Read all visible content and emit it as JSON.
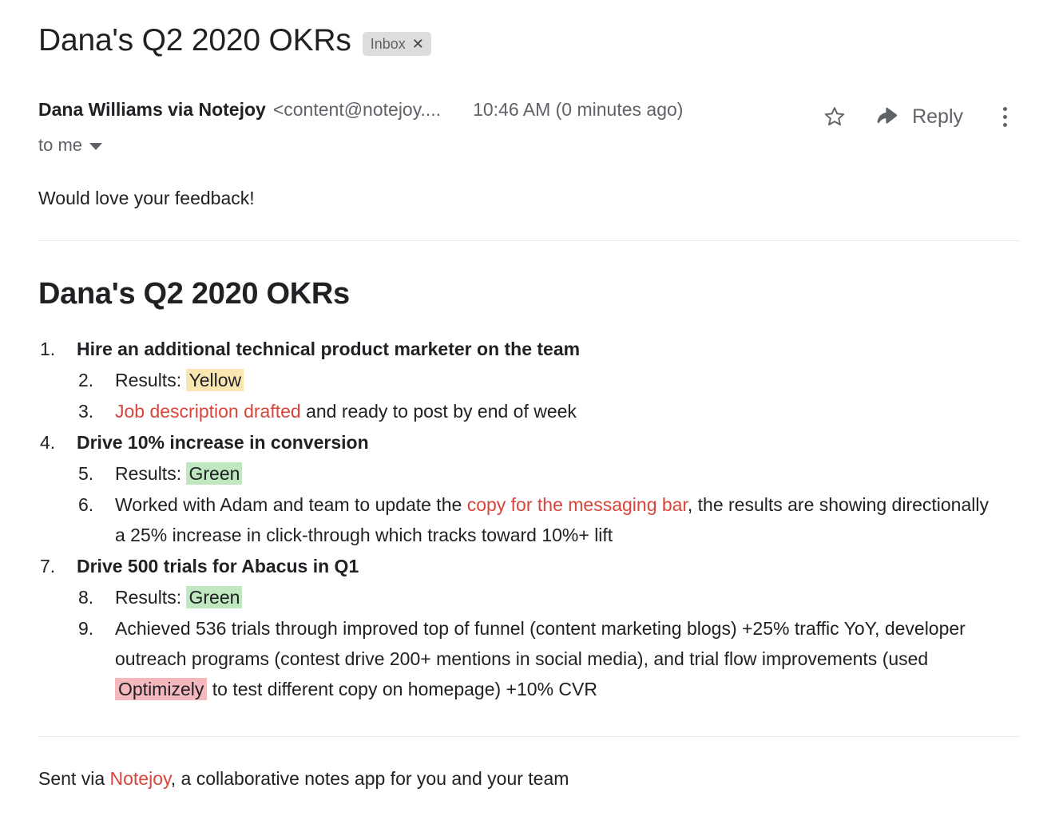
{
  "subject": {
    "title": "Dana's Q2 2020 OKRs",
    "label": "Inbox",
    "label_close": "✕"
  },
  "message_header": {
    "sender_name": "Dana Williams via Notejoy",
    "sender_email": "<content@notejoy....",
    "timestamp": "10:46 AM (0 minutes ago)",
    "recipient": "to me",
    "actions": {
      "star": "star-icon",
      "reply_label": "Reply",
      "reply_icon": "reply-arrow-icon",
      "more": "more-vertical-icon"
    }
  },
  "intro": {
    "text": "Would love your feedback!"
  },
  "note": {
    "title": "Dana's Q2 2020 OKRs",
    "items": [
      {
        "number": "1.",
        "level": 1,
        "bold": true,
        "parts": [
          {
            "type": "text",
            "value": "Hire an additional technical product marketer on the team"
          }
        ]
      },
      {
        "number": "2.",
        "level": 2,
        "bold": false,
        "parts": [
          {
            "type": "text",
            "value": "Results: "
          },
          {
            "type": "highlight-yellow",
            "value": "Yellow"
          }
        ]
      },
      {
        "number": "3.",
        "level": 2,
        "bold": false,
        "parts": [
          {
            "type": "link",
            "value": "Job description drafted"
          },
          {
            "type": "text",
            "value": " and ready to post by end of week"
          }
        ]
      },
      {
        "number": "4.",
        "level": 1,
        "bold": true,
        "parts": [
          {
            "type": "text",
            "value": "Drive 10% increase in conversion"
          }
        ]
      },
      {
        "number": "5.",
        "level": 2,
        "bold": false,
        "parts": [
          {
            "type": "text",
            "value": "Results: "
          },
          {
            "type": "highlight-green",
            "value": "Green"
          }
        ]
      },
      {
        "number": "6.",
        "level": 2,
        "bold": false,
        "parts": [
          {
            "type": "text",
            "value": "Worked with Adam and team to update the "
          },
          {
            "type": "link",
            "value": "copy for the messaging bar"
          },
          {
            "type": "text",
            "value": ", the results are showing directionally a 25% increase in click-through which tracks toward 10%+ lift"
          }
        ]
      },
      {
        "number": "7.",
        "level": 1,
        "bold": true,
        "parts": [
          {
            "type": "text",
            "value": "Drive 500 trials for Abacus in Q1"
          }
        ]
      },
      {
        "number": "8.",
        "level": 2,
        "bold": false,
        "parts": [
          {
            "type": "text",
            "value": "Results: "
          },
          {
            "type": "highlight-green",
            "value": "Green"
          }
        ]
      },
      {
        "number": "9.",
        "level": 2,
        "bold": false,
        "parts": [
          {
            "type": "text",
            "value": "Achieved 536 trials through improved top of funnel (content marketing blogs) +25% traffic YoY, developer outreach programs (contest drive 200+ mentions in social media), and trial flow improvements (used "
          },
          {
            "type": "highlight-pink",
            "value": "Optimizely"
          },
          {
            "type": "text",
            "value": " to test different copy on homepage) +10% CVR"
          }
        ]
      }
    ]
  },
  "footer": {
    "parts": [
      {
        "type": "text",
        "value": "Sent via "
      },
      {
        "type": "link",
        "value": "Notejoy"
      },
      {
        "type": "text",
        "value": ", a collaborative notes app for you and your team"
      }
    ]
  },
  "colors": {
    "link_red": "#d9453a",
    "highlight_yellow": "#fae6b0",
    "highlight_green": "#bfe8c0",
    "highlight_pink": "#f4b8bd",
    "text_primary": "#202124",
    "text_secondary": "#5f6368",
    "chip_bg": "#ddddde",
    "divider": "#e8eaed"
  }
}
